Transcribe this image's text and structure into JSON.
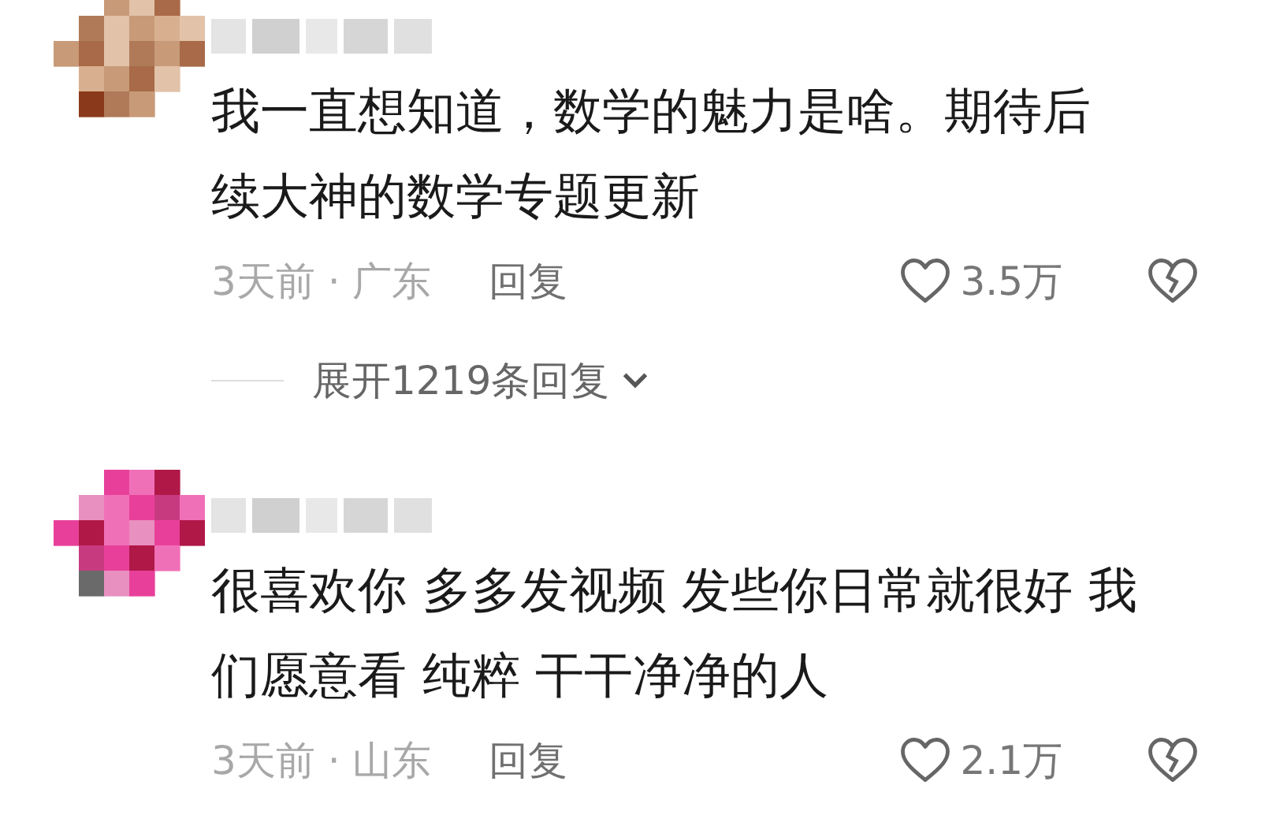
{
  "comments": [
    {
      "text_lines": [
        "我一直想知道，数学的魅力是啥。期待后",
        "续大神的数学专题更新"
      ],
      "time_location": "3天前 · 广东",
      "reply": "回复",
      "likes": "3.5万",
      "replies_link": "展开1219条回复"
    },
    {
      "text_lines": [
        "很喜欢你 多多发视频 发些你日常就很好 我",
        "们愿意看 纯粹 干干净净的人"
      ],
      "time_location": "3天前 · 山东",
      "reply": "回复",
      "likes": "2.1万"
    }
  ]
}
